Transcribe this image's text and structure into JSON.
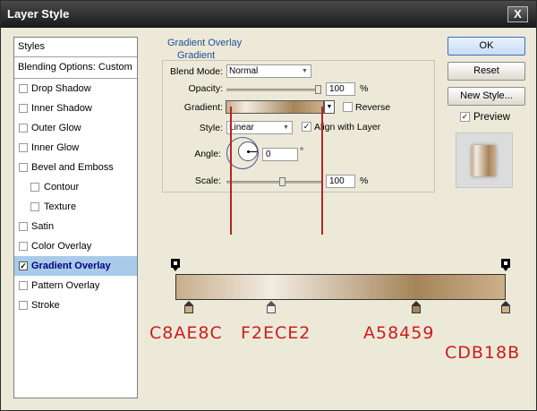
{
  "window": {
    "title": "Layer Style",
    "close_label": "X"
  },
  "styles_list": {
    "header": "Styles",
    "blending": "Blending Options: Custom",
    "items": [
      {
        "label": "Drop Shadow",
        "checked": false,
        "indent": false,
        "selected": false
      },
      {
        "label": "Inner Shadow",
        "checked": false,
        "indent": false,
        "selected": false
      },
      {
        "label": "Outer Glow",
        "checked": false,
        "indent": false,
        "selected": false
      },
      {
        "label": "Inner Glow",
        "checked": false,
        "indent": false,
        "selected": false
      },
      {
        "label": "Bevel and Emboss",
        "checked": false,
        "indent": false,
        "selected": false
      },
      {
        "label": "Contour",
        "checked": false,
        "indent": true,
        "selected": false
      },
      {
        "label": "Texture",
        "checked": false,
        "indent": true,
        "selected": false
      },
      {
        "label": "Satin",
        "checked": false,
        "indent": false,
        "selected": false
      },
      {
        "label": "Color Overlay",
        "checked": false,
        "indent": false,
        "selected": false
      },
      {
        "label": "Gradient Overlay",
        "checked": true,
        "indent": false,
        "selected": true
      },
      {
        "label": "Pattern Overlay",
        "checked": false,
        "indent": false,
        "selected": false
      },
      {
        "label": "Stroke",
        "checked": false,
        "indent": false,
        "selected": false
      }
    ]
  },
  "panel": {
    "section_title": "Gradient Overlay",
    "group_title": "Gradient",
    "blend_mode": {
      "label": "Blend Mode:",
      "value": "Normal"
    },
    "opacity": {
      "label": "Opacity:",
      "value": "100",
      "unit": "%"
    },
    "gradient": {
      "label": "Gradient:",
      "reverse_label": "Reverse",
      "reverse_checked": false
    },
    "style": {
      "label": "Style:",
      "value": "Linear",
      "align_label": "Align with Layer",
      "align_checked": true
    },
    "angle": {
      "label": "Angle:",
      "value": "0",
      "unit": "°"
    },
    "scale": {
      "label": "Scale:",
      "value": "100",
      "unit": "%"
    }
  },
  "buttons": {
    "ok": "OK",
    "reset": "Reset",
    "new_style": "New Style...",
    "preview_label": "Preview",
    "preview_checked": true
  },
  "gradient_stops": [
    {
      "color": "#C8AE8C",
      "label": "C8AE8C",
      "location_pct": 4
    },
    {
      "color": "#F2ECE2",
      "label": "F2ECE2",
      "location_pct": 29
    },
    {
      "color": "#A58459",
      "label": "A58459",
      "location_pct": 73
    },
    {
      "color": "#CDB18B",
      "label": "CDB18B",
      "location_pct": 100
    }
  ],
  "opacity_stops": [
    0,
    100
  ]
}
